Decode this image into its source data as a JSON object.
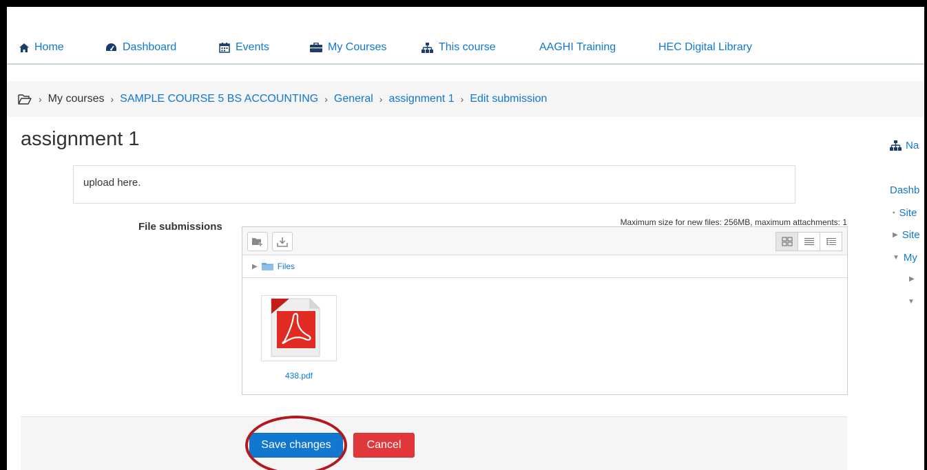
{
  "nav": {
    "items": [
      {
        "label": "Home",
        "icon": "home-icon"
      },
      {
        "label": "Dashboard",
        "icon": "dashboard-icon"
      },
      {
        "label": "Events",
        "icon": "calendar-icon"
      },
      {
        "label": "My Courses",
        "icon": "briefcase-icon"
      },
      {
        "label": "This course",
        "icon": "sitemap-icon"
      },
      {
        "label": "AAGHI Training"
      },
      {
        "label": "HEC Digital Library"
      }
    ]
  },
  "breadcrumb": {
    "icon": "folder-open-icon",
    "items": [
      "My courses",
      "SAMPLE COURSE 5 BS ACCOUNTING",
      "General",
      "assignment 1",
      "Edit submission"
    ],
    "separator": "›"
  },
  "page": {
    "title": "assignment 1",
    "intro": "upload here."
  },
  "submission": {
    "label": "File submissions",
    "limits": "Maximum size for new files: 256MB, maximum attachments: 1",
    "path_label": "Files",
    "file": {
      "name": "438.pdf",
      "icon": "pdf-icon"
    }
  },
  "actions": {
    "save": "Save changes",
    "cancel": "Cancel"
  },
  "right_nav": {
    "heading": "Na",
    "root": "Dashb",
    "items": [
      "Site",
      "Site",
      "My"
    ]
  },
  "colors": {
    "link": "#1177d1",
    "save": "#1177d1",
    "cancel": "#e3383b",
    "highlight": "#b1191e"
  }
}
